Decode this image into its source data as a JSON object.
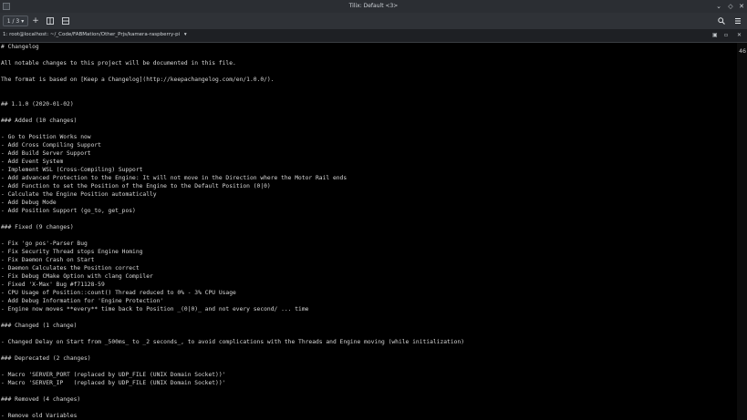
{
  "window": {
    "title": "Tilix: Default <3>"
  },
  "toolbar": {
    "session_label": "1 / 3",
    "add_label": "+",
    "search_icon": "search-icon",
    "menu_icon": "hamburger-menu-icon"
  },
  "tab": {
    "label": "1: root@localhost: ~/_Code/FABMation/Other_Prjs/kamera-raspberry-pi"
  },
  "terminal": {
    "line_count": "46",
    "lines": [
      "# Changelog",
      "",
      "All notable changes to this project will be documented in this file.",
      "",
      "The format is based on [Keep a Changelog](http://keepachangelog.com/en/1.0.0/).",
      "",
      "",
      "## 1.1.0 (2020-01-02)",
      "",
      "### Added (10 changes)",
      "",
      "- Go to Position Works now",
      "- Add Cross Compiling Support",
      "- Add Build Server Support",
      "- Add Event System",
      "- Implement WSL (Cross-Compiling) Support",
      "- Add advanced Protection to the Engine: It will not move in the Direction where the Motor Rail ends",
      "- Add Function to set the Position of the Engine to the Default Position (0|0)",
      "- Calculate the Engine Position automatically",
      "- Add Debug Mode",
      "- Add Position Support (go_to, get_pos)",
      "",
      "### Fixed (9 changes)",
      "",
      "- Fix 'go pos'-Parser Bug",
      "- Fix Security Thread stops Engine Homing",
      "- Fix Daemon Crash on Start",
      "- Daemon Calculates the Position correct",
      "- Fix Debug CMake Option with clang Compiler",
      "- Fixed 'X-Max' Bug #f71128-59",
      "- CPU Usage of Position::count() Thread reduced to 0% - 3% CPU Usage",
      "- Add Debug Information for 'Engine Protection'",
      "- Engine now moves **every** time back to Position _(0|0)_ and not every second/ ... time",
      "",
      "### Changed (1 change)",
      "",
      "- Changed Delay on Start from _500ms_ to _2 seconds_, to avoid complications with the Threads and Engine moving (while initialization)",
      "",
      "### Deprecated (2 changes)",
      "",
      "- Macro 'SERVER_PORT (replaced by UDP_FILE (UNIX Domain Socket))'",
      "- Macro 'SERVER_IP   (replaced by UDP_FILE (UNIX Domain Socket))'",
      "",
      "### Removed (4 changes)",
      "",
      "- Remove old Variables"
    ]
  }
}
